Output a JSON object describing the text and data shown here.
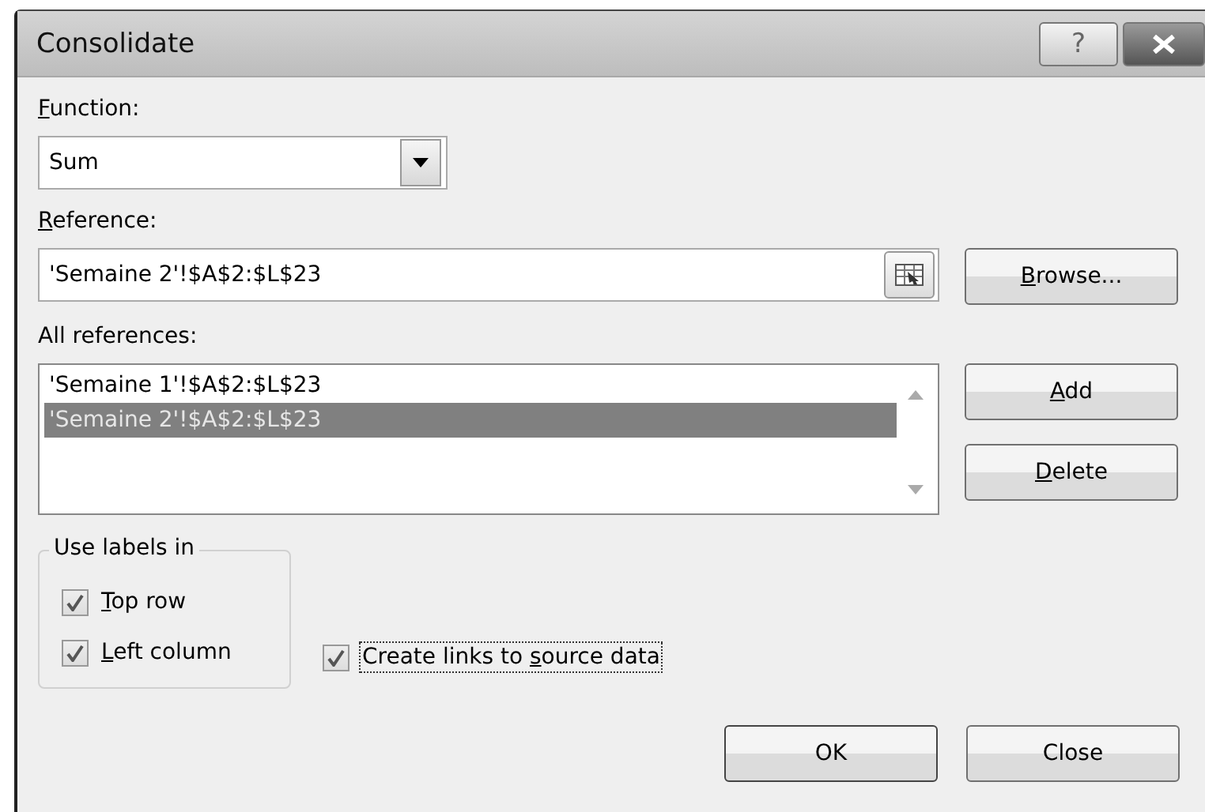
{
  "window": {
    "title": "Consolidate",
    "help_button": "?"
  },
  "function": {
    "label": [
      {
        "text": "F",
        "underlined": true
      },
      {
        "text": "unction:",
        "underlined": false
      }
    ],
    "value": "Sum"
  },
  "reference": {
    "label": [
      {
        "text": "R",
        "underlined": true
      },
      {
        "text": "eference:",
        "underlined": false
      }
    ],
    "value": "'Semaine 2'!$A$2:$L$23"
  },
  "browse_button": {
    "label": [
      {
        "text": "B",
        "underlined": true
      },
      {
        "text": "rowse...",
        "underlined": false
      }
    ]
  },
  "all_references": {
    "label": "All references:",
    "items": [
      {
        "text": "'Semaine 1'!$A$2:$L$23",
        "selected": false
      },
      {
        "text": "'Semaine 2'!$A$2:$L$23",
        "selected": true
      }
    ]
  },
  "side_buttons": [
    {
      "label": [
        {
          "text": "A",
          "underlined": true
        },
        {
          "text": "dd",
          "underlined": false
        }
      ]
    },
    {
      "label": [
        {
          "text": "D",
          "underlined": true
        },
        {
          "text": "elete",
          "underlined": false
        }
      ]
    }
  ],
  "use_labels": {
    "title": "Use labels in",
    "options": [
      {
        "label": [
          {
            "text": "T",
            "underlined": true
          },
          {
            "text": "op row",
            "underlined": false
          }
        ],
        "checked": true
      },
      {
        "label": [
          {
            "text": "L",
            "underlined": true
          },
          {
            "text": "eft column",
            "underlined": false
          }
        ],
        "checked": true
      }
    ]
  },
  "create_links": {
    "label": [
      {
        "text": "Create links to ",
        "underlined": false
      },
      {
        "text": "s",
        "underlined": true
      },
      {
        "text": "ource data",
        "underlined": false
      }
    ],
    "checked": true,
    "focused": true
  },
  "footer_buttons": [
    {
      "label": "OK",
      "default": true
    },
    {
      "label": "Close",
      "default": false
    }
  ]
}
